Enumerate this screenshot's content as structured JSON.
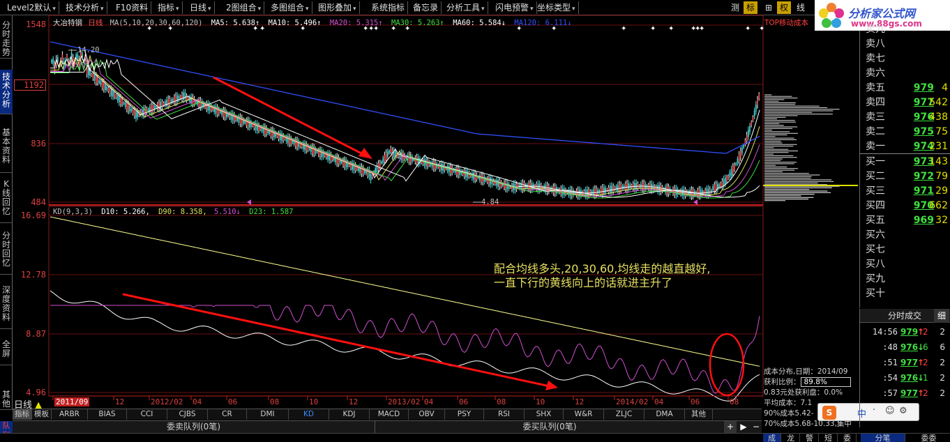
{
  "menu": {
    "items": [
      "Level2默认",
      "技术分析",
      "F10资料",
      "指标",
      "日线",
      "2图组合",
      "多图组合",
      "图形叠加",
      "系统指标",
      "备忘录",
      "分析工具",
      "闪电预警",
      "坐标类型"
    ],
    "right_buttons": [
      "测",
      "标",
      "⊞",
      "权",
      "线"
    ]
  },
  "logo": {
    "title": "分析家公式网",
    "url_text": "www.88gs.com"
  },
  "left_tabs": [
    "分时走势",
    "技术分析",
    "基本资料",
    "K线回忆",
    "分时回忆",
    "深度资料",
    "全屏",
    "其他"
  ],
  "main_chart": {
    "stock_name": "大冶特钢",
    "period": "日线",
    "ma_params": "MA(5,10,20,30,60,120)",
    "ma_values": [
      {
        "label": "MA5: 5.638↑",
        "color": "#ffffff"
      },
      {
        "label": "MA10: 5.496↑",
        "color": "#ffffff"
      },
      {
        "label": "MA20: 5.315↑",
        "color": "#d050d0"
      },
      {
        "label": "MA30: 5.263↑",
        "color": "#40e040"
      },
      {
        "label": "MA60: 5.584↓",
        "color": "#ffffff"
      },
      {
        "label": "MA120: 6.111↓",
        "color": "#3050ff"
      }
    ],
    "top_right_label": "TOP移动成本",
    "y_labels": [
      "1548",
      "1192",
      "836",
      "484"
    ],
    "annot_high": "14.20",
    "annot_low": "4.84"
  },
  "kd_chart": {
    "params": "KD(9,3,3)",
    "d10": "D10: 5.266,",
    "d90": "D90: 8.358,",
    "val_magenta": "5.510↓",
    "d23": "D23: 1.587",
    "y_labels": [
      "16.69",
      "12.78",
      "8.87",
      "4.96"
    ],
    "note_line1": "配合均线多头,20,30,60,均线走的越直越好,",
    "note_line2": "一直下行的黄线向上的话就进主升了"
  },
  "x_axis": {
    "labels": [
      "2011/09",
      "12",
      "2012/02",
      "04",
      "06",
      "08",
      "10",
      "12",
      "2013/02",
      "04",
      "06",
      "08",
      "10",
      "12",
      "2014/02",
      "04",
      "06",
      "08"
    ],
    "period_label": "日线"
  },
  "indicator_tabs": [
    "指标",
    "模板",
    "ARBR",
    "BIAS",
    "CCI",
    "CJBS",
    "CR",
    "DMI",
    "KD",
    "KDJ",
    "MACD",
    "OBV",
    "PSY",
    "RSI",
    "SHX",
    "W&R",
    "ZLJC",
    "DMA",
    "其他"
  ],
  "queue_bar": {
    "left_corner": "队列",
    "sell_queue": "委卖队列(0笔)",
    "buy_queue": "委买队列(0笔)"
  },
  "order_book": {
    "asks": [
      {
        "label": "卖九",
        "price": "",
        "vol": ""
      },
      {
        "label": "卖八",
        "price": "",
        "vol": ""
      },
      {
        "label": "卖七",
        "price": "",
        "vol": ""
      },
      {
        "label": "卖六",
        "price": "",
        "vol": ""
      },
      {
        "label": "卖五",
        "price": "979",
        "vol": "4"
      },
      {
        "label": "卖四",
        "price": "977",
        "vol": "542"
      },
      {
        "label": "卖三",
        "price": "976",
        "vol": "438"
      },
      {
        "label": "卖二",
        "price": "975",
        "vol": "75"
      },
      {
        "label": "卖一",
        "price": "974",
        "vol": "231"
      }
    ],
    "bids": [
      {
        "label": "买一",
        "price": "973",
        "vol": "143"
      },
      {
        "label": "买二",
        "price": "972",
        "vol": "79"
      },
      {
        "label": "买三",
        "price": "971",
        "vol": "29"
      },
      {
        "label": "买四",
        "price": "970",
        "vol": "662"
      },
      {
        "label": "买五",
        "price": "969",
        "vol": "32"
      },
      {
        "label": "买六",
        "price": "",
        "vol": ""
      },
      {
        "label": "买七",
        "price": "",
        "vol": ""
      },
      {
        "label": "买八",
        "price": "",
        "vol": ""
      },
      {
        "label": "买九",
        "price": "",
        "vol": ""
      },
      {
        "label": "买十",
        "price": "",
        "vol": ""
      }
    ]
  },
  "trades": {
    "title": "分时成交",
    "detail_btn": "细",
    "rows": [
      {
        "time": "14:56",
        "price": "979",
        "dir": "↑",
        "qty": "2",
        "vol": "2"
      },
      {
        "time": ":48",
        "price": "976",
        "dir": "↓",
        "qty": "6",
        "vol": "6"
      },
      {
        "time": ":51",
        "price": "977",
        "dir": "↑",
        "qty": "2",
        "vol": "2"
      },
      {
        "time": ":54",
        "price": "976",
        "dir": "↓",
        "qty": "1",
        "vol": "2"
      },
      {
        "time": ":57",
        "price": "977",
        "dir": "↑",
        "qty": "2",
        "vol": "2"
      }
    ]
  },
  "cost_dist": {
    "line1": "成本分布,日期：2014/09",
    "line2_label": "获利比例：",
    "line2_value": "89.8%",
    "line3": "0.83元处获利盘：0.0%",
    "line4": "平均成本：7.1",
    "line5": "90%成本5.42-",
    "line6": "70%成本5.68-10.33,集中"
  },
  "ime": {
    "label": "中",
    "extra": "·"
  },
  "bottom_tabs_left": [
    "成",
    "龙",
    "警",
    "短",
    "委"
  ],
  "bottom_tabs_right": [
    "分笔",
    "委委"
  ]
}
